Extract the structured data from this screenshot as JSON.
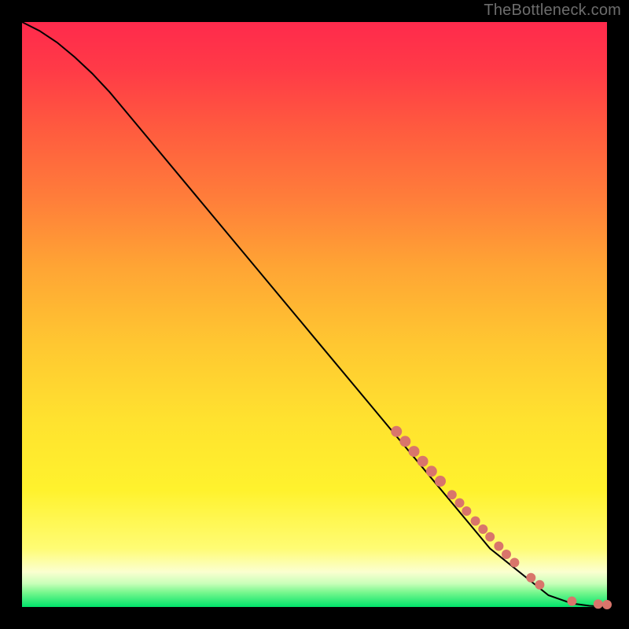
{
  "watermark": "TheBottleneck.com",
  "colors": {
    "dot": "#d9756b",
    "curve": "#000000",
    "frame_bg": "#000000"
  },
  "chart_data": {
    "type": "line",
    "title": "",
    "xlabel": "",
    "ylabel": "",
    "xlim": [
      0,
      1
    ],
    "ylim": [
      0,
      1
    ],
    "grid": false,
    "legend": false,
    "series": [
      {
        "name": "curve",
        "x": [
          0.0,
          0.03,
          0.06,
          0.09,
          0.12,
          0.15,
          0.2,
          0.3,
          0.4,
          0.5,
          0.6,
          0.7,
          0.8,
          0.9,
          0.94,
          0.97,
          1.0
        ],
        "y": [
          1.0,
          0.985,
          0.965,
          0.94,
          0.912,
          0.88,
          0.82,
          0.7,
          0.58,
          0.46,
          0.34,
          0.22,
          0.1,
          0.02,
          0.006,
          0.002,
          0.0
        ]
      }
    ],
    "points": [
      {
        "x": 0.64,
        "y": 0.3,
        "r": 7
      },
      {
        "x": 0.655,
        "y": 0.283,
        "r": 7
      },
      {
        "x": 0.67,
        "y": 0.266,
        "r": 7
      },
      {
        "x": 0.685,
        "y": 0.249,
        "r": 7
      },
      {
        "x": 0.7,
        "y": 0.232,
        "r": 7
      },
      {
        "x": 0.715,
        "y": 0.215,
        "r": 7
      },
      {
        "x": 0.735,
        "y": 0.192,
        "r": 6
      },
      {
        "x": 0.748,
        "y": 0.178,
        "r": 6
      },
      {
        "x": 0.76,
        "y": 0.164,
        "r": 6
      },
      {
        "x": 0.775,
        "y": 0.147,
        "r": 6
      },
      {
        "x": 0.788,
        "y": 0.133,
        "r": 6
      },
      {
        "x": 0.8,
        "y": 0.12,
        "r": 6
      },
      {
        "x": 0.815,
        "y": 0.104,
        "r": 6
      },
      {
        "x": 0.828,
        "y": 0.09,
        "r": 6
      },
      {
        "x": 0.842,
        "y": 0.076,
        "r": 6
      },
      {
        "x": 0.87,
        "y": 0.05,
        "r": 6
      },
      {
        "x": 0.885,
        "y": 0.038,
        "r": 6
      },
      {
        "x": 0.94,
        "y": 0.01,
        "r": 6
      },
      {
        "x": 0.985,
        "y": 0.005,
        "r": 6
      },
      {
        "x": 1.0,
        "y": 0.004,
        "r": 6
      }
    ]
  }
}
